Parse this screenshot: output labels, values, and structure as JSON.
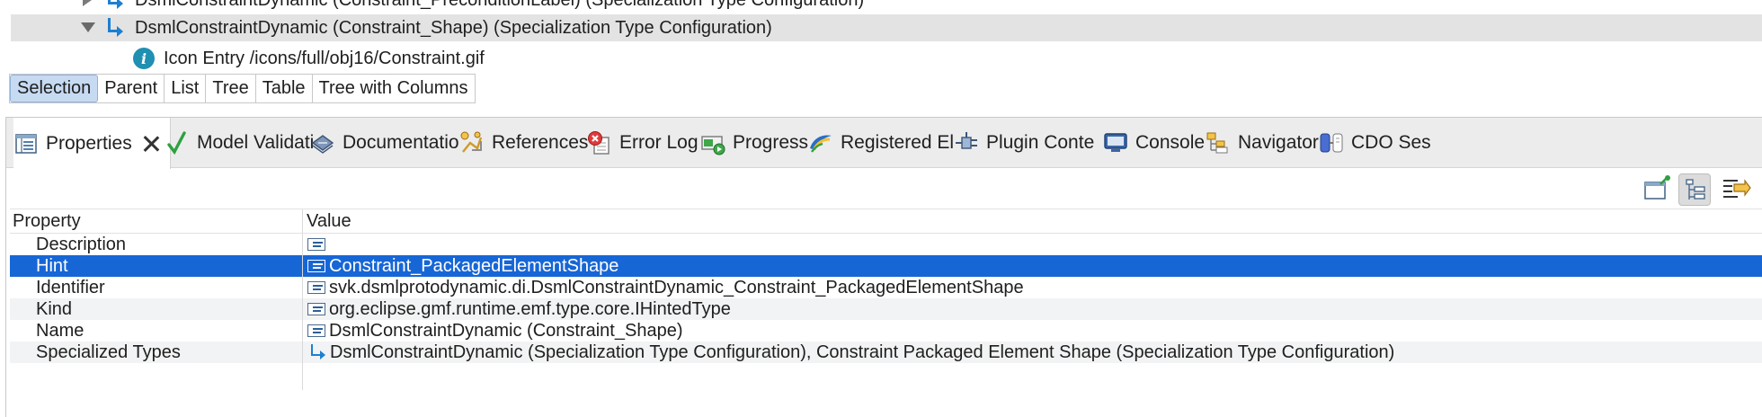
{
  "tree": {
    "rows": [
      {
        "text": "DsmlConstraintDynamic (Constraint_PreconditionLabel) (Specialization Type Configuration)"
      },
      {
        "text": "DsmlConstraintDynamic (Constraint_Shape) (Specialization Type Configuration)"
      },
      {
        "text": "Icon Entry /icons/full/obj16/Constraint.gif"
      }
    ]
  },
  "view_modes": [
    "Selection",
    "Parent",
    "List",
    "Tree",
    "Table",
    "Tree with Columns"
  ],
  "active_view_mode": "Selection",
  "panel": {
    "tabs": [
      {
        "label": "Properties",
        "icon": "properties-icon"
      },
      {
        "label": "Model Validati",
        "icon": "checkmark-icon"
      },
      {
        "label": "Documentatio",
        "icon": "documentation-icon"
      },
      {
        "label": "References",
        "icon": "references-icon"
      },
      {
        "label": "Error Log",
        "icon": "error-log-icon"
      },
      {
        "label": "Progress",
        "icon": "progress-icon"
      },
      {
        "label": "Registered El",
        "icon": "registered-elements-icon"
      },
      {
        "label": "Plugin Conte",
        "icon": "plugin-icon"
      },
      {
        "label": "Console",
        "icon": "console-icon"
      },
      {
        "label": "Navigator",
        "icon": "navigator-icon"
      },
      {
        "label": "CDO Ses",
        "icon": "cdo-sessions-icon"
      }
    ]
  },
  "properties": {
    "header": {
      "property": "Property",
      "value": "Value"
    },
    "rows": [
      {
        "property": "Description",
        "value": "",
        "icon": "property-value-icon"
      },
      {
        "property": "Hint",
        "value": "Constraint_PackagedElementShape",
        "icon": "property-value-icon",
        "selected": true
      },
      {
        "property": "Identifier",
        "value": "svk.dsmlprotodynamic.di.DsmlConstraintDynamic_Constraint_PackagedElementShape",
        "icon": "property-value-icon"
      },
      {
        "property": "Kind",
        "value": "org.eclipse.gmf.runtime.emf.type.core.IHintedType",
        "icon": "property-value-icon"
      },
      {
        "property": "Name",
        "value": "DsmlConstraintDynamic (Constraint_Shape)",
        "icon": "property-value-icon"
      },
      {
        "property": "Specialized Types",
        "value": "DsmlConstraintDynamic (Specialization Type Configuration), Constraint Packaged Element Shape (Specialization Type Configuration)",
        "icon": "specialization-icon"
      }
    ]
  },
  "colors": {
    "selection": "#1766d6",
    "accent": "#1d7fd1",
    "active_mode": "#c6daf2"
  }
}
